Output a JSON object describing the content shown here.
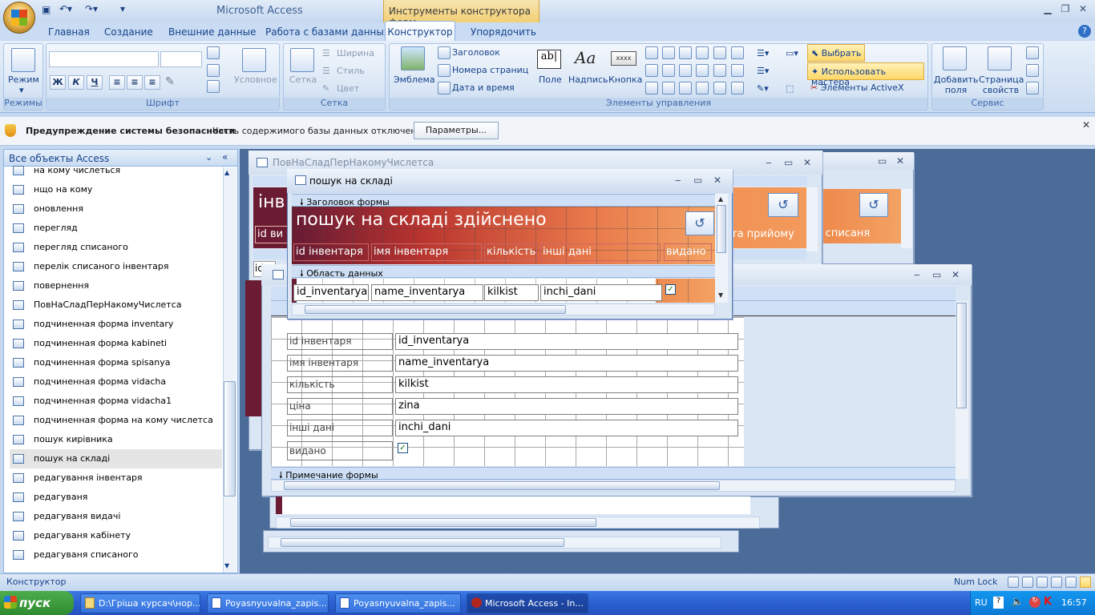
{
  "app": {
    "title": "Microsoft Access",
    "context_tab_title": "Инструменты конструктора форм"
  },
  "tabs": [
    "Главная",
    "Создание",
    "Внешние данные",
    "Работа с базами данных",
    "Конструктор",
    "Упорядочить"
  ],
  "ribbon": {
    "modes": {
      "button": "Режим",
      "label": "Режимы"
    },
    "font": {
      "label": "Шрифт",
      "conditional": "Условное",
      "bold": "Ж",
      "italic": "К",
      "underline": "Ч"
    },
    "grid": {
      "button": "Сетка",
      "width": "Ширина",
      "style": "Стиль",
      "color": "Цвет",
      "label": "Сетка"
    },
    "controls": {
      "emblem": "Эмблема",
      "heading": "Заголовок",
      "page_numbers": "Номера страниц",
      "date_time": "Дата и время",
      "field": "Поле",
      "caption": "Надпись",
      "button": "Кнопка",
      "field_icon": "ab|",
      "caption_icon": "Aa",
      "button_icon": "xxxx",
      "select": "Выбрать",
      "use_wizard": "Использовать мастера",
      "activex": "Элементы ActiveX",
      "label": "Элементы управления"
    },
    "tools": {
      "add_fields": "Добавить поля",
      "property_sheet": "Страница свойств",
      "label": "Сервис"
    }
  },
  "security": {
    "title": "Предупреждение системы безопасности",
    "message": "Часть содержимого базы данных отключено",
    "button": "Параметры..."
  },
  "nav": {
    "header": "Все объекты Access",
    "items": [
      "на кому числеться",
      "нщо на кому",
      "оновлення",
      "перегляд",
      "перегляд списаного",
      "перелік списаного інвентаря",
      "повернення",
      "ПовНаСладПерНакомуЧислетса",
      "подчиненная форма inventary",
      "подчиненная форма kabineti",
      "подчиненная форма spisanya",
      "подчиненная форма vidacha",
      "подчиненная форма vidacha1",
      "подчиненная форма на кому числетса",
      "пошук кирівника",
      "пошук на складі",
      "редагування інвентаря",
      "редагуваня",
      "редагуваня видачі",
      "редагуваня кабінету",
      "редагуваня списаного"
    ],
    "selected_index": 15
  },
  "back_window": {
    "title": "ПовНаСладПерНакомуЧислетса",
    "partial_header": "інв",
    "partial_id": "id ви",
    "partial_id2": "id",
    "label_receive": "та прийому",
    "label_writeoff": "та списаня"
  },
  "front_window": {
    "title": "пошук на складі",
    "header_section": "Заголовок формы",
    "heading": "пошук на складі здійснено",
    "columns": [
      "id інвентаря",
      "імя інвентаря",
      "кількість",
      "інші дані",
      "видано"
    ],
    "detail_section": "Область данных",
    "fields": [
      "id_inventarya",
      "name_inventarya",
      "kilkist",
      "inchi_dani"
    ],
    "checked": true
  },
  "mid_window": {
    "labels": [
      "id інвентаря",
      "імя інвентаря",
      "кількість",
      "ціна",
      "інші дані",
      "видано"
    ],
    "fields": [
      "id_inventarya",
      "name_inventarya",
      "kilkist",
      "zina",
      "inchi_dani"
    ],
    "footer_section": "Примечание формы",
    "checked": true
  },
  "status": {
    "left": "Конструктор",
    "num_lock": "Num Lock"
  },
  "taskbar": {
    "start": "пуск",
    "tasks": [
      "D:\\Гріша курсач\\нор...",
      "Poyasnyuvalna_zapis...",
      "Poyasnyuvalna_zapis...",
      "Microsoft Access - In..."
    ],
    "lang": "RU",
    "time": "16:57"
  }
}
